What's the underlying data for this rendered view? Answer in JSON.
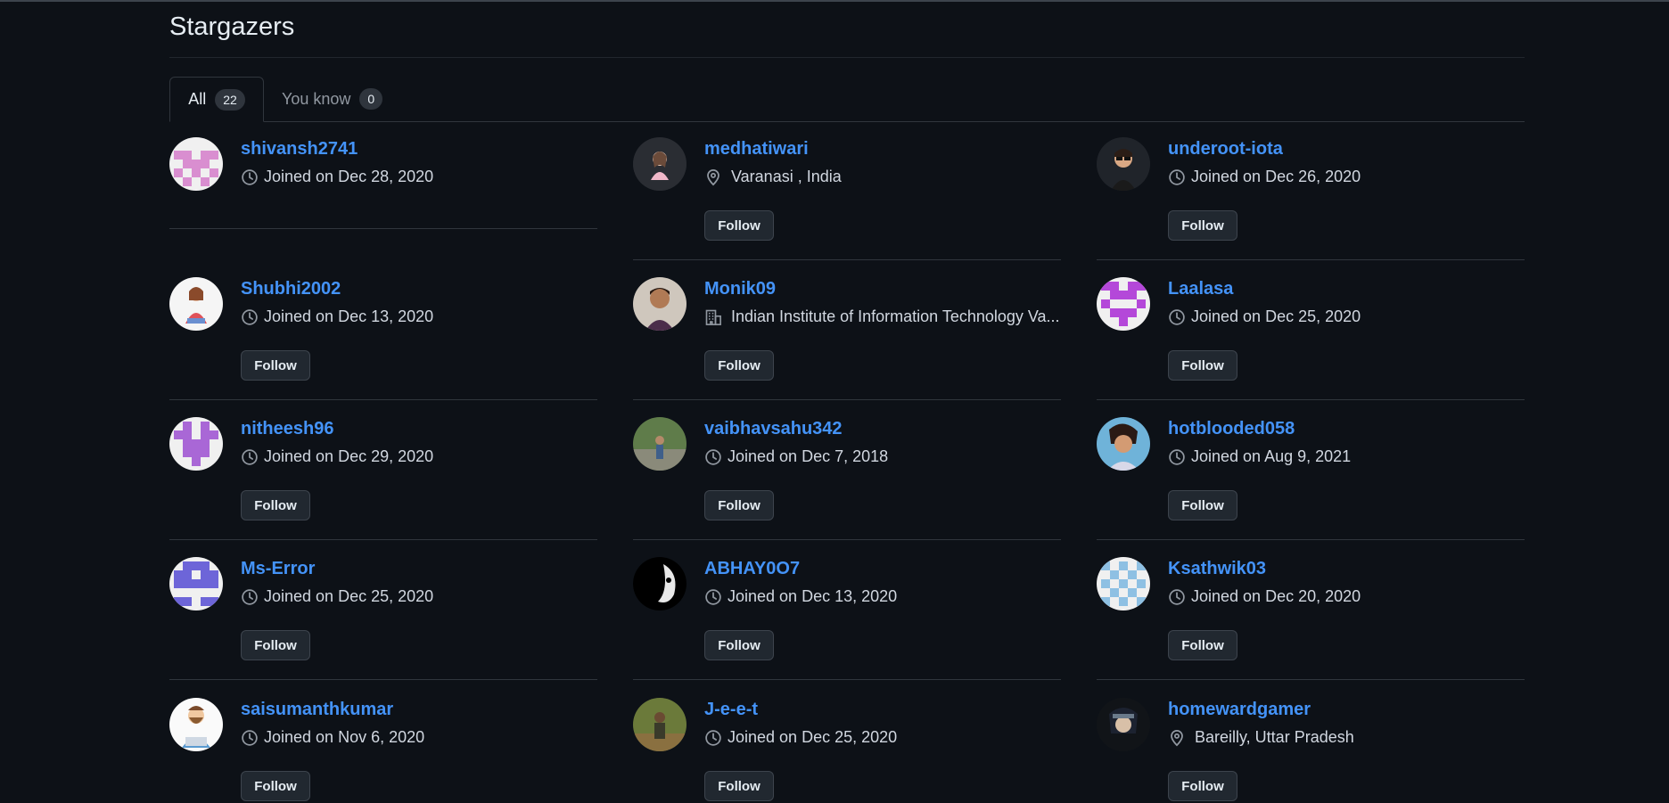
{
  "page": {
    "title": "Stargazers"
  },
  "tabs": [
    {
      "label": "All",
      "count": "22"
    },
    {
      "label": "You know",
      "count": "0"
    }
  ],
  "follow_label": "Follow",
  "users": [
    {
      "username": "shivansh2741",
      "meta": "Joined on Dec 28, 2020",
      "meta_icon": "clock-icon",
      "avatar": "identicon-pink"
    },
    {
      "username": "medhatiwari",
      "meta": "Varanasi , India",
      "meta_icon": "location-icon",
      "avatar": "photo-illustration-girl"
    },
    {
      "username": "underoot-iota",
      "meta": "Joined on Dec 26, 2020",
      "meta_icon": "clock-icon",
      "avatar": "photo-cartoon-man"
    },
    {
      "username": "Shubhi2002",
      "meta": "Joined on Dec 13, 2020",
      "meta_icon": "clock-icon",
      "avatar": "photo-illustration-woman"
    },
    {
      "username": "Monik09",
      "meta": "Indian Institute of Information Technology Va...",
      "meta_icon": "organization-icon",
      "avatar": "photo-man"
    },
    {
      "username": "Laalasa",
      "meta": "Joined on Dec 25, 2020",
      "meta_icon": "clock-icon",
      "avatar": "identicon-magenta"
    },
    {
      "username": "nitheesh96",
      "meta": "Joined on Dec 29, 2020",
      "meta_icon": "clock-icon",
      "avatar": "identicon-purple"
    },
    {
      "username": "vaibhavsahu342",
      "meta": "Joined on Dec 7, 2018",
      "meta_icon": "clock-icon",
      "avatar": "photo-outdoor"
    },
    {
      "username": "hotblooded058",
      "meta": "Joined on Aug 9, 2021",
      "meta_icon": "clock-icon",
      "avatar": "photo-anime"
    },
    {
      "username": "Ms-Error",
      "meta": "Joined on Dec 25, 2020",
      "meta_icon": "clock-icon",
      "avatar": "identicon-blue"
    },
    {
      "username": "ABHAY0O7",
      "meta": "Joined on Dec 13, 2020",
      "meta_icon": "clock-icon",
      "avatar": "photo-dark-face"
    },
    {
      "username": "Ksathwik03",
      "meta": "Joined on Dec 20, 2020",
      "meta_icon": "clock-icon",
      "avatar": "identicon-lightblue"
    },
    {
      "username": "saisumanthkumar",
      "meta": "Joined on Nov 6, 2020",
      "meta_icon": "clock-icon",
      "avatar": "photo-cartoon-bearded"
    },
    {
      "username": "J-e-e-t",
      "meta": "Joined on Dec 25, 2020",
      "meta_icon": "clock-icon",
      "avatar": "photo-outdoor-person"
    },
    {
      "username": "homewardgamer",
      "meta": "Bareilly, Uttar Pradesh",
      "meta_icon": "location-icon",
      "avatar": "photo-anime-dark"
    }
  ],
  "colors": {
    "background": "#0d1117",
    "link": "#4493f8",
    "text": "#e6edf3",
    "muted": "#9198a1",
    "border": "#30363d",
    "button_bg": "#212830"
  }
}
